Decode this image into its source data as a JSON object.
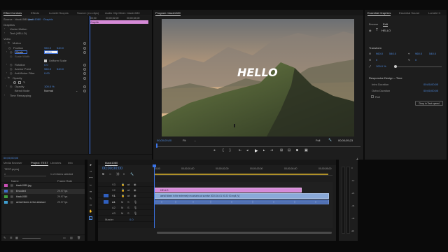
{
  "effect_controls": {
    "tabs": [
      "Effect Controls",
      "Effects",
      "Lumetri Scopes",
      "Source: (no clips)",
      "Audio Clip Mixer: black1080"
    ],
    "master_clip": "Source · black1080.psd",
    "sequence_clip": "black1080 · Graphic",
    "mini_ruler": [
      "00;00",
      "00;00;02;00",
      "00;00;04;00"
    ],
    "mini_clip_label": "Graphic",
    "section_graphics": "Graphics",
    "vector_motion": "Vector Motion",
    "text_layer": "Text (HELLO)",
    "section_video": "Video",
    "motion": "Motion",
    "position_label": "Position",
    "position_x": "960.0",
    "position_y": "540.0",
    "scale_label": "Scale",
    "scale_value": "100.0",
    "scale_width_label": "Scale Width",
    "uniform_scale": "Uniform Scale",
    "rotation_label": "Rotation",
    "rotation_value": "0.0",
    "anchor_label": "Anchor Point",
    "anchor_x": "960.0",
    "anchor_y": "540.0",
    "flicker_label": "Anti-flicker Filter",
    "flicker_value": "0.00",
    "opacity_section": "Opacity",
    "opacity_label": "Opacity",
    "opacity_value": "100.0 %",
    "blend_label": "Blend Mode",
    "blend_value": "Normal",
    "time_remap": "Time Remapping",
    "timecode": "00;00;00;00"
  },
  "program": {
    "title": "Program: black1080",
    "overlay_text": "HELLO",
    "timecode_left": "00;00;00;00",
    "fit": "Fit",
    "quality": "Full",
    "timecode_right": "00;00;05;23"
  },
  "essential_graphics": {
    "tabs": [
      "Essential Graphics",
      "Essential Sound",
      "Lumetri C"
    ],
    "subtabs": [
      "Browse",
      "Edit"
    ],
    "layer_name": "HELLO",
    "transform_title": "Transform",
    "pos_x": "960.0",
    "pos_y": "540.0",
    "anchor_x": "960.0",
    "anchor_y": "540.0",
    "scale_pct": "100.0 %",
    "rotation": "0",
    "opacity": "0",
    "responsive_title": "Responsive Design – Time",
    "intro_label": "Intro Duration",
    "intro_value": "00;00;00;00",
    "outro_label": "Outro Duration",
    "outro_value": "00;00;00;00",
    "roll_label": "Roll",
    "master_button": "Drop in Test speed"
  },
  "project": {
    "tabs": [
      "Media Browser",
      "Project: TEST",
      "Libraries",
      "Info"
    ],
    "file": "TEST.prproj",
    "count": "1 of 4 items selected",
    "columns": [
      "Name",
      "Frame Rate",
      "Media Start"
    ],
    "items": [
      {
        "name": "black1080.jpg",
        "rate": "",
        "color": "#c94fb6"
      },
      {
        "name": "Encoded",
        "rate": "29.97 fps",
        "color": "#3f6ec8"
      },
      {
        "name": "black1080",
        "rate": "29.97 fps",
        "color": "#3fa040"
      },
      {
        "name": "aerial hikers in the abstract",
        "rate": "29.97 fps",
        "color": "#3f9fd0"
      }
    ]
  },
  "timeline": {
    "tab": "black1080",
    "timecode": "00;00;00;00",
    "ruler": [
      "00;00",
      "00;00;01;00",
      "00;00;02;00",
      "00;00;03;00",
      "00;00;04;00",
      "00;00;05;00"
    ],
    "video_tracks": [
      "V3",
      "V2",
      "V1"
    ],
    "audio_tracks": [
      "A1",
      "A2",
      "A3"
    ],
    "master_label": "Master",
    "master_value": "0.0",
    "graphic_clip": "HELLO",
    "video_clip": "aerial hikers in the extremely mountains at sunrise 2020-04-01 00 22 00.mp4 [V]",
    "meter_labels": [
      "0",
      "-12",
      "-24",
      "-36",
      "-48",
      "dB"
    ]
  },
  "colors": {
    "accent_blue": "#3d6fd6",
    "timecode_blue": "#4d8ae0",
    "graphic_clip": "#d58ad7",
    "video_clip": "#8aa9d8",
    "audio_clip": "#4a6bb0",
    "playhead": "#3b74e8"
  }
}
